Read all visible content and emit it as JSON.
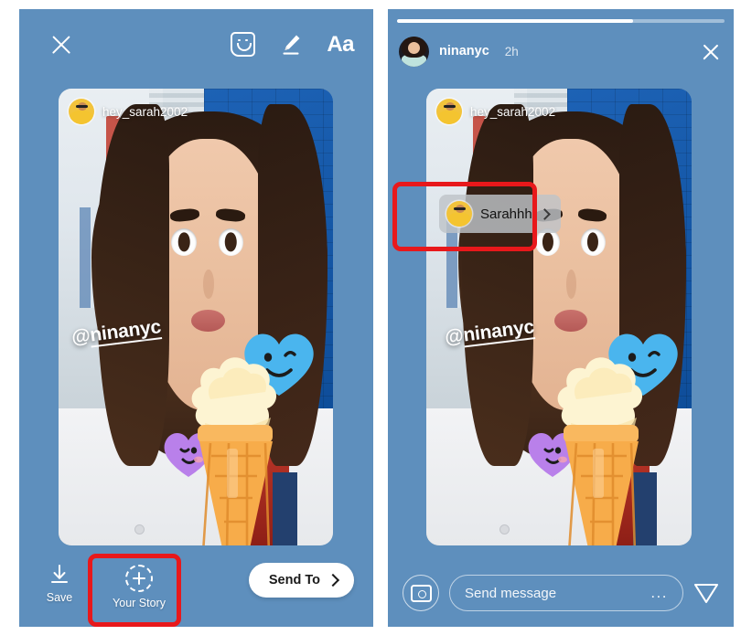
{
  "meta": {
    "accent_red": "#e8181b",
    "panel_bg": "#5e8fbd",
    "white": "#ffffff"
  },
  "left_panel": {
    "name": "story-composer",
    "toolbar": {
      "close_label": "close-icon",
      "sticker_label": "sticker-icon",
      "draw_label": "draw-pen-icon",
      "text_label": "Aa"
    },
    "photo": {
      "tagged_user": "hey_sarah2002",
      "handle_overlay": "@ninanyc",
      "stickers": [
        "ice-cream-cone",
        "blue-heart",
        "purple-heart"
      ]
    },
    "bottom": {
      "save_label": "Save",
      "your_story_label": "Your Story",
      "send_to_label": "Send To"
    },
    "highlight": "your-story-button"
  },
  "right_panel": {
    "name": "story-viewer",
    "progress_percent": 72,
    "header": {
      "username": "ninanyc",
      "time_ago": "2h",
      "close_label": "close-icon"
    },
    "photo": {
      "tagged_user": "hey_sarah2002",
      "handle_overlay": "@ninanyc",
      "stickers": [
        "ice-cream-cone",
        "blue-heart",
        "purple-heart"
      ]
    },
    "mention_sticker": {
      "label": "Sarahhh"
    },
    "message_bar": {
      "camera_label": "camera-icon",
      "placeholder": "Send message",
      "more_label": "...",
      "send_label": "send-icon"
    },
    "highlight": "mention-sticker"
  }
}
